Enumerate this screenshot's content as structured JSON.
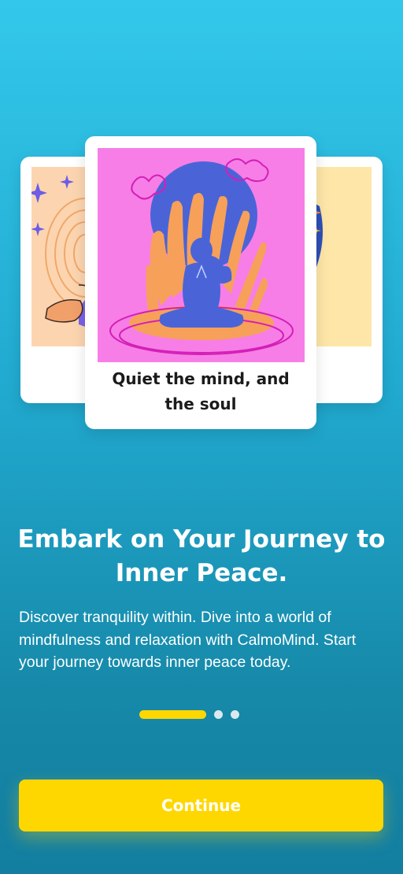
{
  "carousel": {
    "cards": [
      {
        "name": "card-left",
        "caption": ""
      },
      {
        "name": "card-center",
        "caption": "Quiet the mind, and the soul"
      },
      {
        "name": "card-right",
        "caption": ""
      }
    ]
  },
  "onboarding": {
    "title": "Embark on Your Journey to Inner Peace.",
    "description": "Discover tranquility within. Dive into a world of mindfulness and relaxation with CalmoMind. Start your journey towards inner peace today."
  },
  "pager": {
    "total": 3,
    "active": 1
  },
  "actions": {
    "continue_label": "Continue"
  },
  "colors": {
    "accent": "#ffd700",
    "background_top": "#33c8eb",
    "background_bottom": "#137ea0",
    "card_art_pink": "#f77ee6",
    "figure_blue": "#4c63d9"
  }
}
